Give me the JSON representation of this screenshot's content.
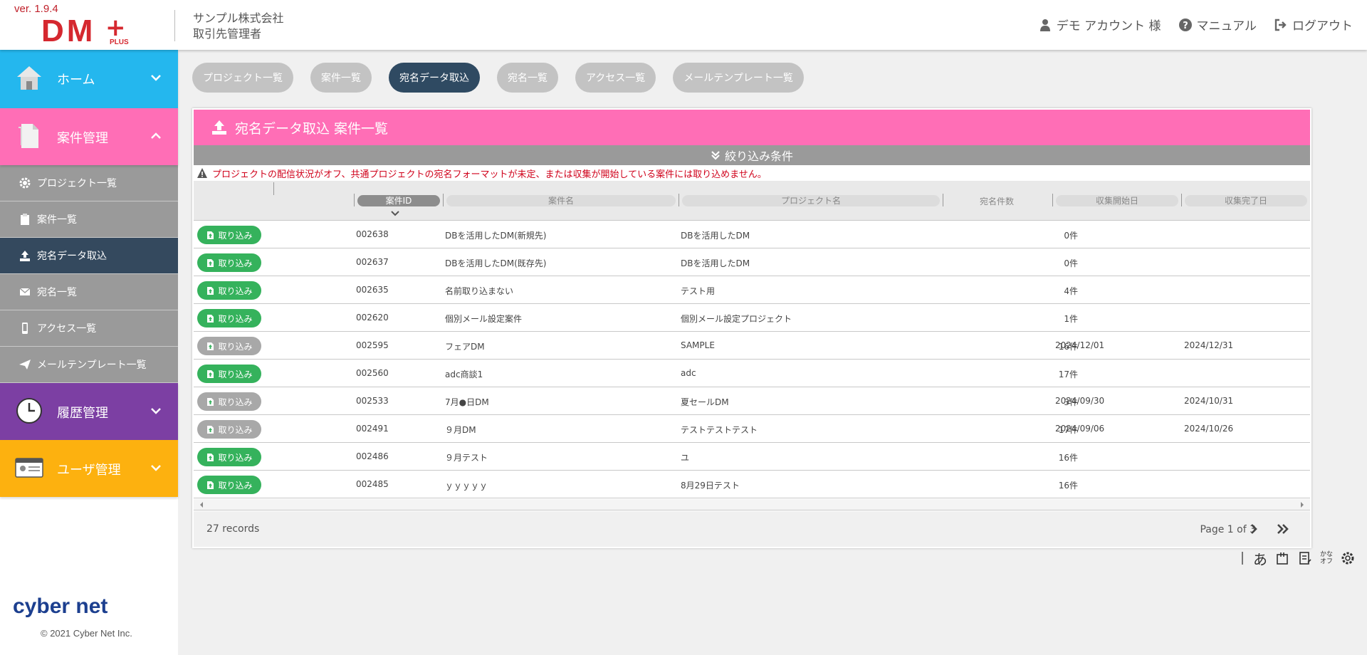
{
  "header": {
    "version": "ver. 1.9.4",
    "logo_text": "DM",
    "logo_plus_symbol": "+",
    "logo_plus_label": "PLUS",
    "company": "サンプル株式会社",
    "role": "取引先管理者",
    "account": "デモ アカウント 様",
    "manual": "マニュアル",
    "logout": "ログアウト"
  },
  "sidebar": {
    "home": "ホーム",
    "case_mgmt": "案件管理",
    "sub_items": [
      {
        "label": "プロジェクト一覧",
        "icon": "gear-icon"
      },
      {
        "label": "案件一覧",
        "icon": "clipboard-icon"
      },
      {
        "label": "宛名データ取込",
        "icon": "upload-icon"
      },
      {
        "label": "宛名一覧",
        "icon": "envelope-icon"
      },
      {
        "label": "アクセス一覧",
        "icon": "mobile-icon"
      },
      {
        "label": "メールテンプレート一覧",
        "icon": "paper-plane-icon"
      }
    ],
    "history_mgmt": "履歴管理",
    "user_mgmt": "ユーザ管理",
    "brand": "cyber net",
    "copyright": "© 2021 Cyber Net Inc."
  },
  "tabs": [
    "プロジェクト一覧",
    "案件一覧",
    "宛名データ取込",
    "宛名一覧",
    "アクセス一覧",
    "メールテンプレート一覧"
  ],
  "active_tab": "宛名データ取込",
  "panel": {
    "title": "宛名データ取込 案件一覧",
    "filter": "絞り込み条件",
    "warning": "プロジェクトの配信状況がオフ、共通プロジェクトの宛名フォーマットが未定、または収集が開始している案件には取り込めません。",
    "columns": {
      "id": "案件ID",
      "name": "案件名",
      "project": "プロジェクト名",
      "count": "宛名件数",
      "start": "収集開始日",
      "end": "収集完了日"
    },
    "import_label": "取り込み",
    "rows": [
      {
        "enabled": true,
        "id": "002638",
        "name": "DBを活用したDM(新規先)",
        "project": "DBを活用したDM",
        "count": "0件",
        "start": "",
        "end": ""
      },
      {
        "enabled": true,
        "id": "002637",
        "name": "DBを活用したDM(既存先)",
        "project": "DBを活用したDM",
        "count": "0件",
        "start": "",
        "end": ""
      },
      {
        "enabled": true,
        "id": "002635",
        "name": "名前取り込まない",
        "project": "テスト用",
        "count": "4件",
        "start": "",
        "end": ""
      },
      {
        "enabled": true,
        "id": "002620",
        "name": "個別メール設定案件",
        "project": "個別メール設定プロジェクト",
        "count": "1件",
        "start": "",
        "end": ""
      },
      {
        "enabled": false,
        "id": "002595",
        "name": "フェアDM",
        "project": "SAMPLE",
        "count": "16件",
        "start": "2024/12/01",
        "end": "2024/12/31"
      },
      {
        "enabled": true,
        "id": "002560",
        "name": "adc商談1",
        "project": "adc",
        "count": "17件",
        "start": "",
        "end": ""
      },
      {
        "enabled": false,
        "id": "002533",
        "name": "7月●日DM",
        "project": "夏セールDM",
        "count": "3件",
        "start": "2024/09/30",
        "end": "2024/10/31"
      },
      {
        "enabled": false,
        "id": "002491",
        "name": "９月DM",
        "project": "テストテストテスト",
        "count": "17件",
        "start": "2024/09/06",
        "end": "2024/10/26"
      },
      {
        "enabled": true,
        "id": "002486",
        "name": "９月テスト",
        "project": "ユ",
        "count": "16件",
        "start": "",
        "end": ""
      },
      {
        "enabled": true,
        "id": "002485",
        "name": "ｙｙｙｙｙ",
        "project": "8月29日テスト",
        "count": "16件",
        "start": "",
        "end": ""
      }
    ],
    "records": "27 records",
    "page_info": "Page 1 of 3"
  },
  "ime": {
    "hiragana": "あ",
    "kana_label_top": "かな",
    "kana_label_bottom": "オフ"
  },
  "colors": {
    "home": "#24b7ee",
    "case": "#ff6eb6",
    "history": "#7c3fa3",
    "user": "#fdb10f",
    "active": "#2f4a62",
    "import_enabled": "#35b25c",
    "import_disabled": "#a8a8a8",
    "warning": "#d0021b"
  }
}
